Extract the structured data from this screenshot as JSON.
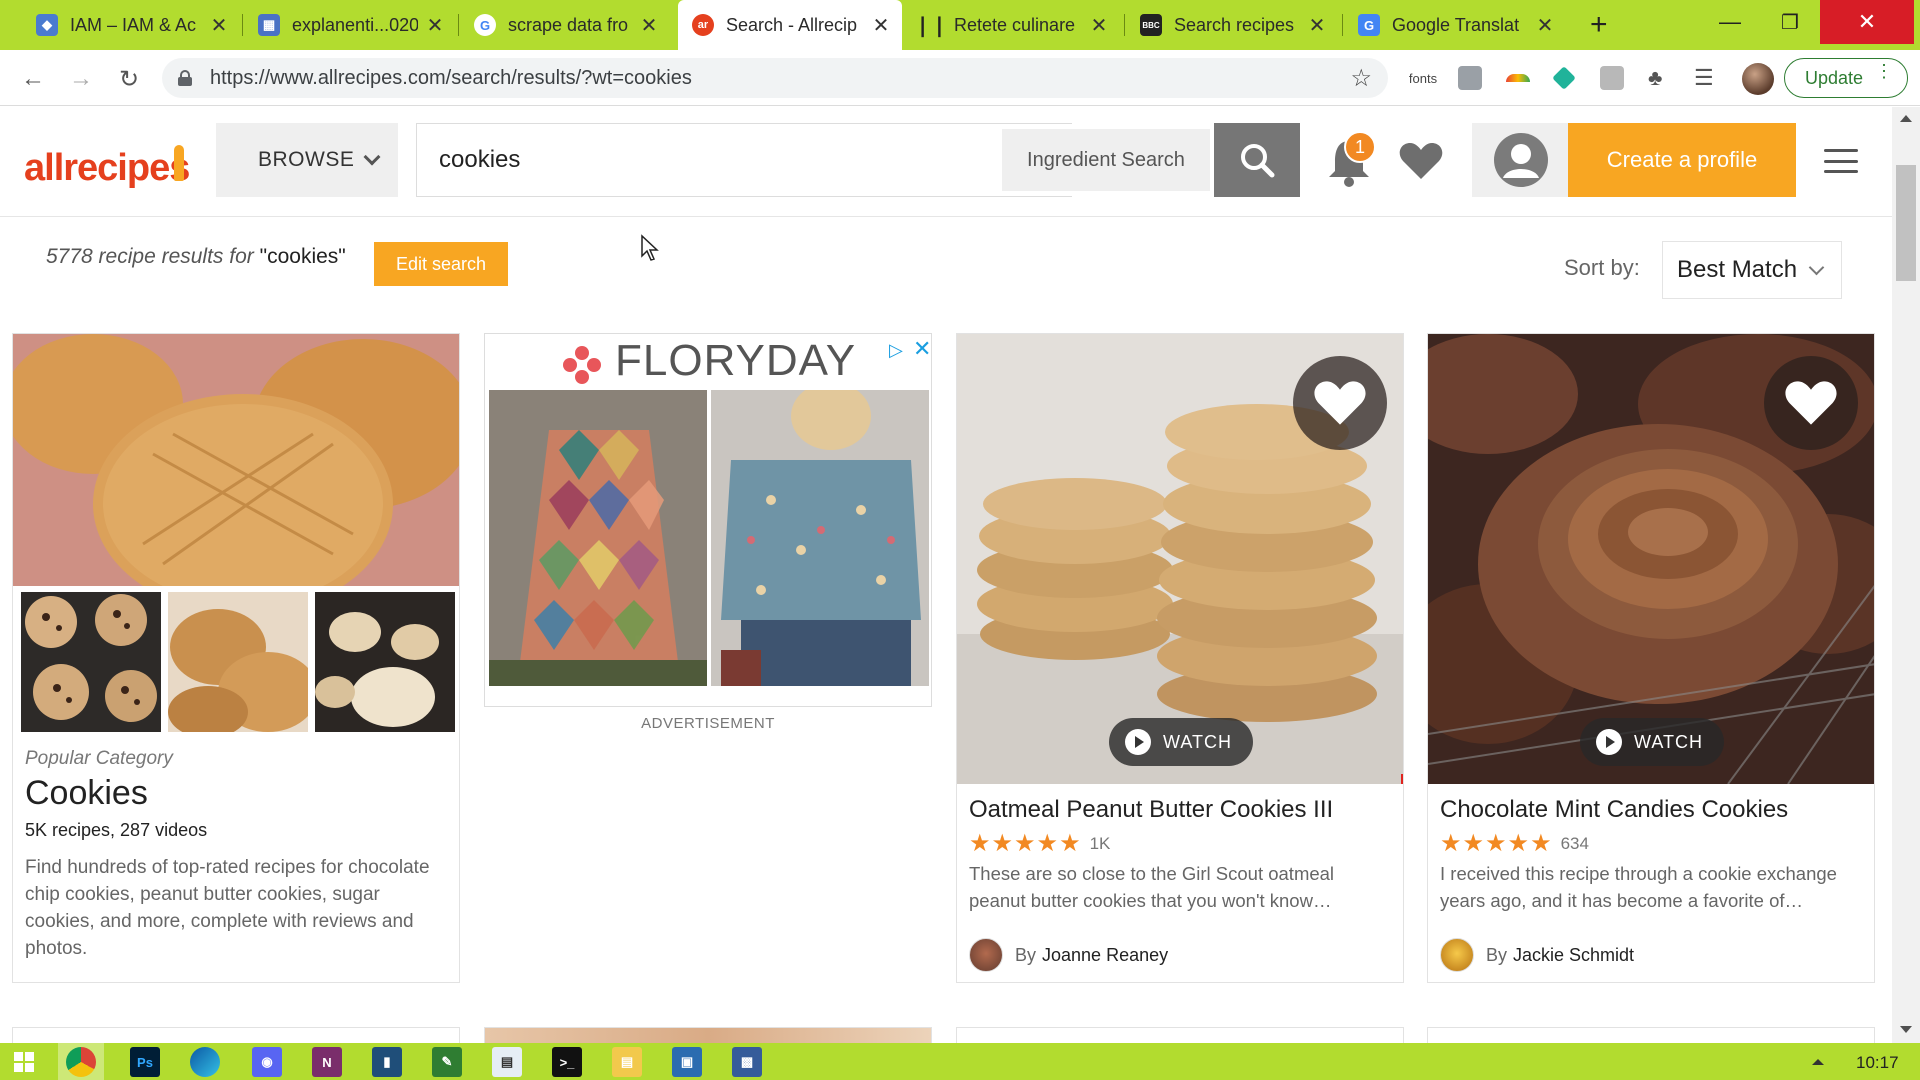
{
  "browser": {
    "tabs": [
      {
        "title": "IAM – IAM & Ac",
        "icon": "shield-icon",
        "color": "#4a7bd0"
      },
      {
        "title": "explanenti...020",
        "icon": "sheet-icon",
        "color": "#4a72c4"
      },
      {
        "title": "scrape data fro",
        "icon": "google-icon",
        "color": "#ffffff"
      },
      {
        "title": "Search - Allrecip",
        "icon": "allrecipes-icon",
        "color": "#e5401e"
      },
      {
        "title": "Retete culinare",
        "icon": "fork-knife-icon",
        "color": "#222222"
      },
      {
        "title": "Search recipes",
        "icon": "bbc-icon",
        "color": "#222222"
      },
      {
        "title": "Google Translat",
        "icon": "translate-icon",
        "color": "#4285f4"
      }
    ],
    "url": "https://www.allrecipes.com/search/results/?wt=cookies",
    "extensions": {
      "fonts_label": "fonts"
    },
    "update_label": "Update"
  },
  "site": {
    "logo_text": "allrecipes",
    "browse_label": "BROWSE",
    "search_value": "cookies",
    "ingredient_search_label": "Ingredient Search",
    "notification_count": "1",
    "create_profile_label": "Create a profile"
  },
  "results": {
    "count_text": "5778 recipe results for",
    "query_text": "\"cookies\"",
    "edit_search_label": "Edit search",
    "sort_by_label": "Sort by:",
    "sort_value": "Best Match"
  },
  "category_card": {
    "label": "Popular Category",
    "title": "Cookies",
    "count": "5K recipes, 287 videos",
    "description": "Find hundreds of top-rated recipes for chocolate chip cookies, peanut butter cookies, sugar cookies, and more, complete with reviews and photos."
  },
  "ad": {
    "brand": "FLORYDAY",
    "caption": "ADVERTISEMENT"
  },
  "recipes": [
    {
      "title": "Oatmeal Peanut Butter Cookies III",
      "rating": 5,
      "review_count": "1K",
      "description": "These are so close to the Girl Scout oatmeal peanut butter cookies that you won't know…",
      "by_label": "By",
      "author": "Joanne Reaney",
      "watch_label": "WATCH"
    },
    {
      "title": "Chocolate Mint Candies Cookies",
      "rating": 5,
      "review_count": "634",
      "description": "I received this recipe through a cookie exchange years ago, and it has become a favorite of…",
      "by_label": "By",
      "author": "Jackie Schmidt",
      "watch_label": "WATCH"
    }
  ],
  "taskbar": {
    "clock": "10:17"
  },
  "colors": {
    "chrome_green": "#b2dc2f",
    "brand_orange": "#f8a622",
    "logo_red": "#e5401e",
    "star_orange": "#f28922"
  }
}
